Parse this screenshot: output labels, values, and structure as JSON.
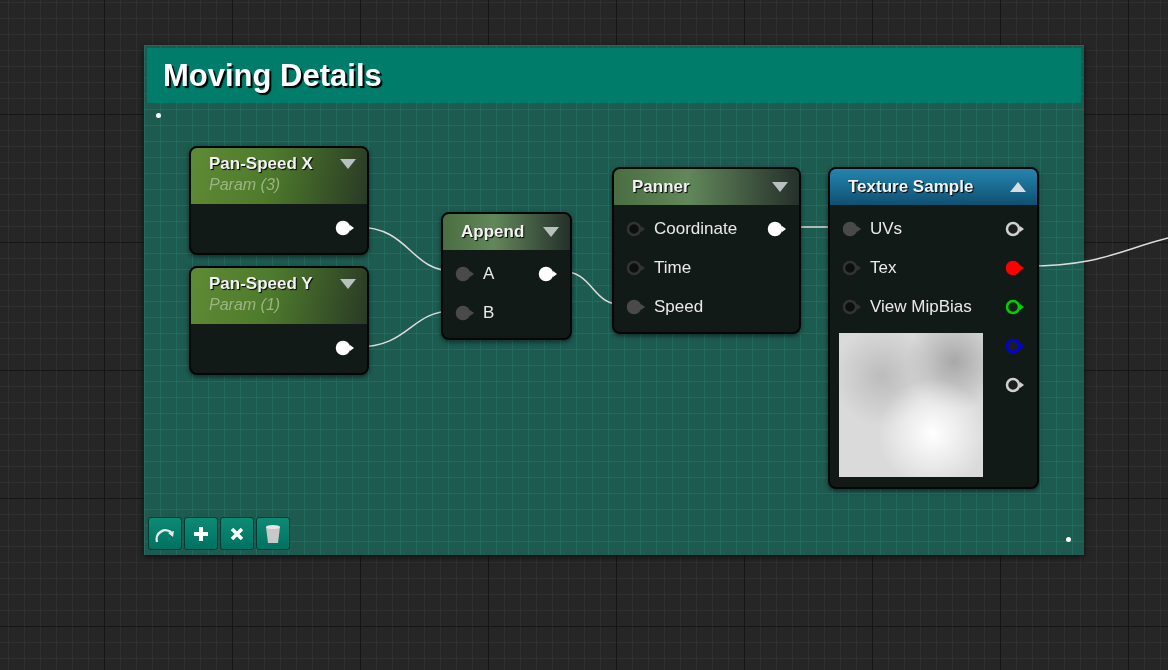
{
  "comment": {
    "title": "Moving Details"
  },
  "nodes": [
    {
      "kind": "parameter",
      "title": "Pan-Speed X",
      "subtitle": "Param (3)",
      "expanded": false,
      "outputs": [
        {
          "connected": true
        }
      ]
    },
    {
      "kind": "parameter",
      "title": "Pan-Speed Y",
      "subtitle": "Param (1)",
      "expanded": false,
      "outputs": [
        {
          "connected": true
        }
      ]
    },
    {
      "kind": "function",
      "title": "Append",
      "expanded": false,
      "inputs": [
        {
          "label": "A",
          "connected": true
        },
        {
          "label": "B",
          "connected": true
        }
      ],
      "outputs": [
        {
          "connected": true
        }
      ]
    },
    {
      "kind": "function",
      "title": "Panner",
      "expanded": false,
      "inputs": [
        {
          "label": "Coordinate",
          "connected": false
        },
        {
          "label": "Time",
          "connected": false
        },
        {
          "label": "Speed",
          "connected": true
        }
      ],
      "outputs": [
        {
          "connected": true
        }
      ]
    },
    {
      "kind": "texture",
      "title": "Texture Sample",
      "expanded": true,
      "inputs": [
        {
          "label": "UVs",
          "connected": true
        },
        {
          "label": "Tex",
          "connected": false
        },
        {
          "label": "View MipBias",
          "connected": false
        }
      ],
      "outputs": [
        {
          "connected": false,
          "color": "#d0d0d0"
        },
        {
          "connected": true,
          "color": "#ff0000"
        },
        {
          "connected": false,
          "color": "#00d000"
        },
        {
          "connected": false,
          "color": "#0000e0"
        },
        {
          "connected": false,
          "color": "#d0d0d0"
        }
      ]
    }
  ],
  "toolbar": [
    {
      "kind": "refresh"
    },
    {
      "kind": "add"
    },
    {
      "kind": "remove"
    },
    {
      "kind": "delete"
    }
  ]
}
